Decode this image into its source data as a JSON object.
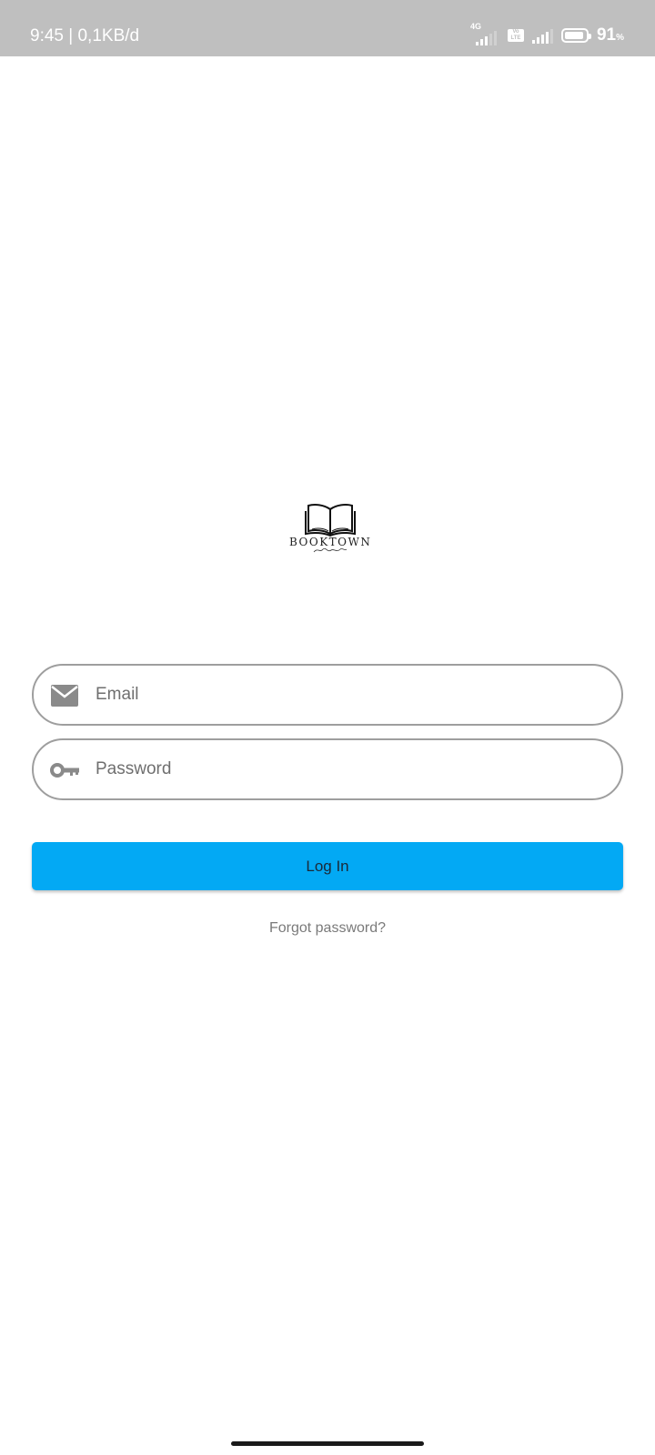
{
  "status_bar": {
    "time": "9:45",
    "separator": "|",
    "network_speed": "0,1KB/d",
    "network_type": "4G",
    "volte_label": "Vo LTE",
    "battery_percent": "91",
    "battery_unit": "%",
    "battery_level": 0.91,
    "icons": [
      "signal-4g-icon",
      "volte-icon",
      "signal-icon",
      "battery-icon"
    ]
  },
  "logo": {
    "brand": "BOOKTOWN",
    "icon": "open-book-icon"
  },
  "form": {
    "email": {
      "placeholder": "Email",
      "value": "",
      "icon": "mail-icon"
    },
    "password": {
      "placeholder": "Password",
      "value": "",
      "icon": "key-icon"
    },
    "login_label": "Log In",
    "forgot_label": "Forgot password?"
  },
  "colors": {
    "status_bar": "#bfbfbf",
    "primary": "#03a9f4",
    "field_border": "#9e9e9e",
    "muted_text": "#7a7a7a"
  }
}
